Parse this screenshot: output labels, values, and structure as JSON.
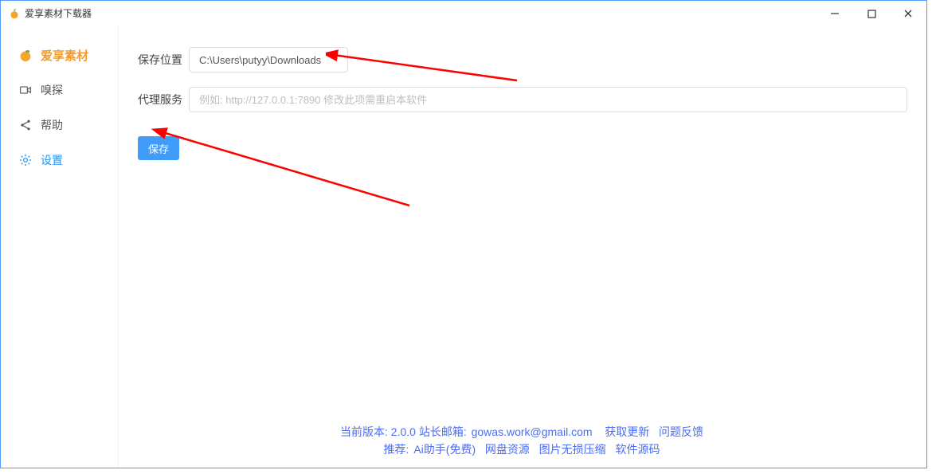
{
  "window": {
    "title": "爱享素材下载器"
  },
  "sidebar": {
    "items": [
      {
        "label": "爱享素材"
      },
      {
        "label": "嗅探"
      },
      {
        "label": "帮助"
      },
      {
        "label": "设置"
      }
    ]
  },
  "form": {
    "save_path_label": "保存位置",
    "save_path_value": "C:\\Users\\putyy\\Downloads",
    "proxy_label": "代理服务",
    "proxy_placeholder": "例如: http://127.0.0.1:7890 修改此项需重启本软件",
    "save_button": "保存"
  },
  "footer": {
    "line1_prefix": "当前版本: ",
    "version": "2.0.0",
    "email_label": "  站长邮箱: ",
    "email": "gowas.work@gmail.com",
    "link_update": "获取更新",
    "link_feedback": "问题反馈",
    "line2_prefix": "推荐:  ",
    "rec1": "Ai助手(免费)",
    "rec2": "网盘资源",
    "rec3": "图片无损压缩",
    "rec4": "软件源码"
  }
}
